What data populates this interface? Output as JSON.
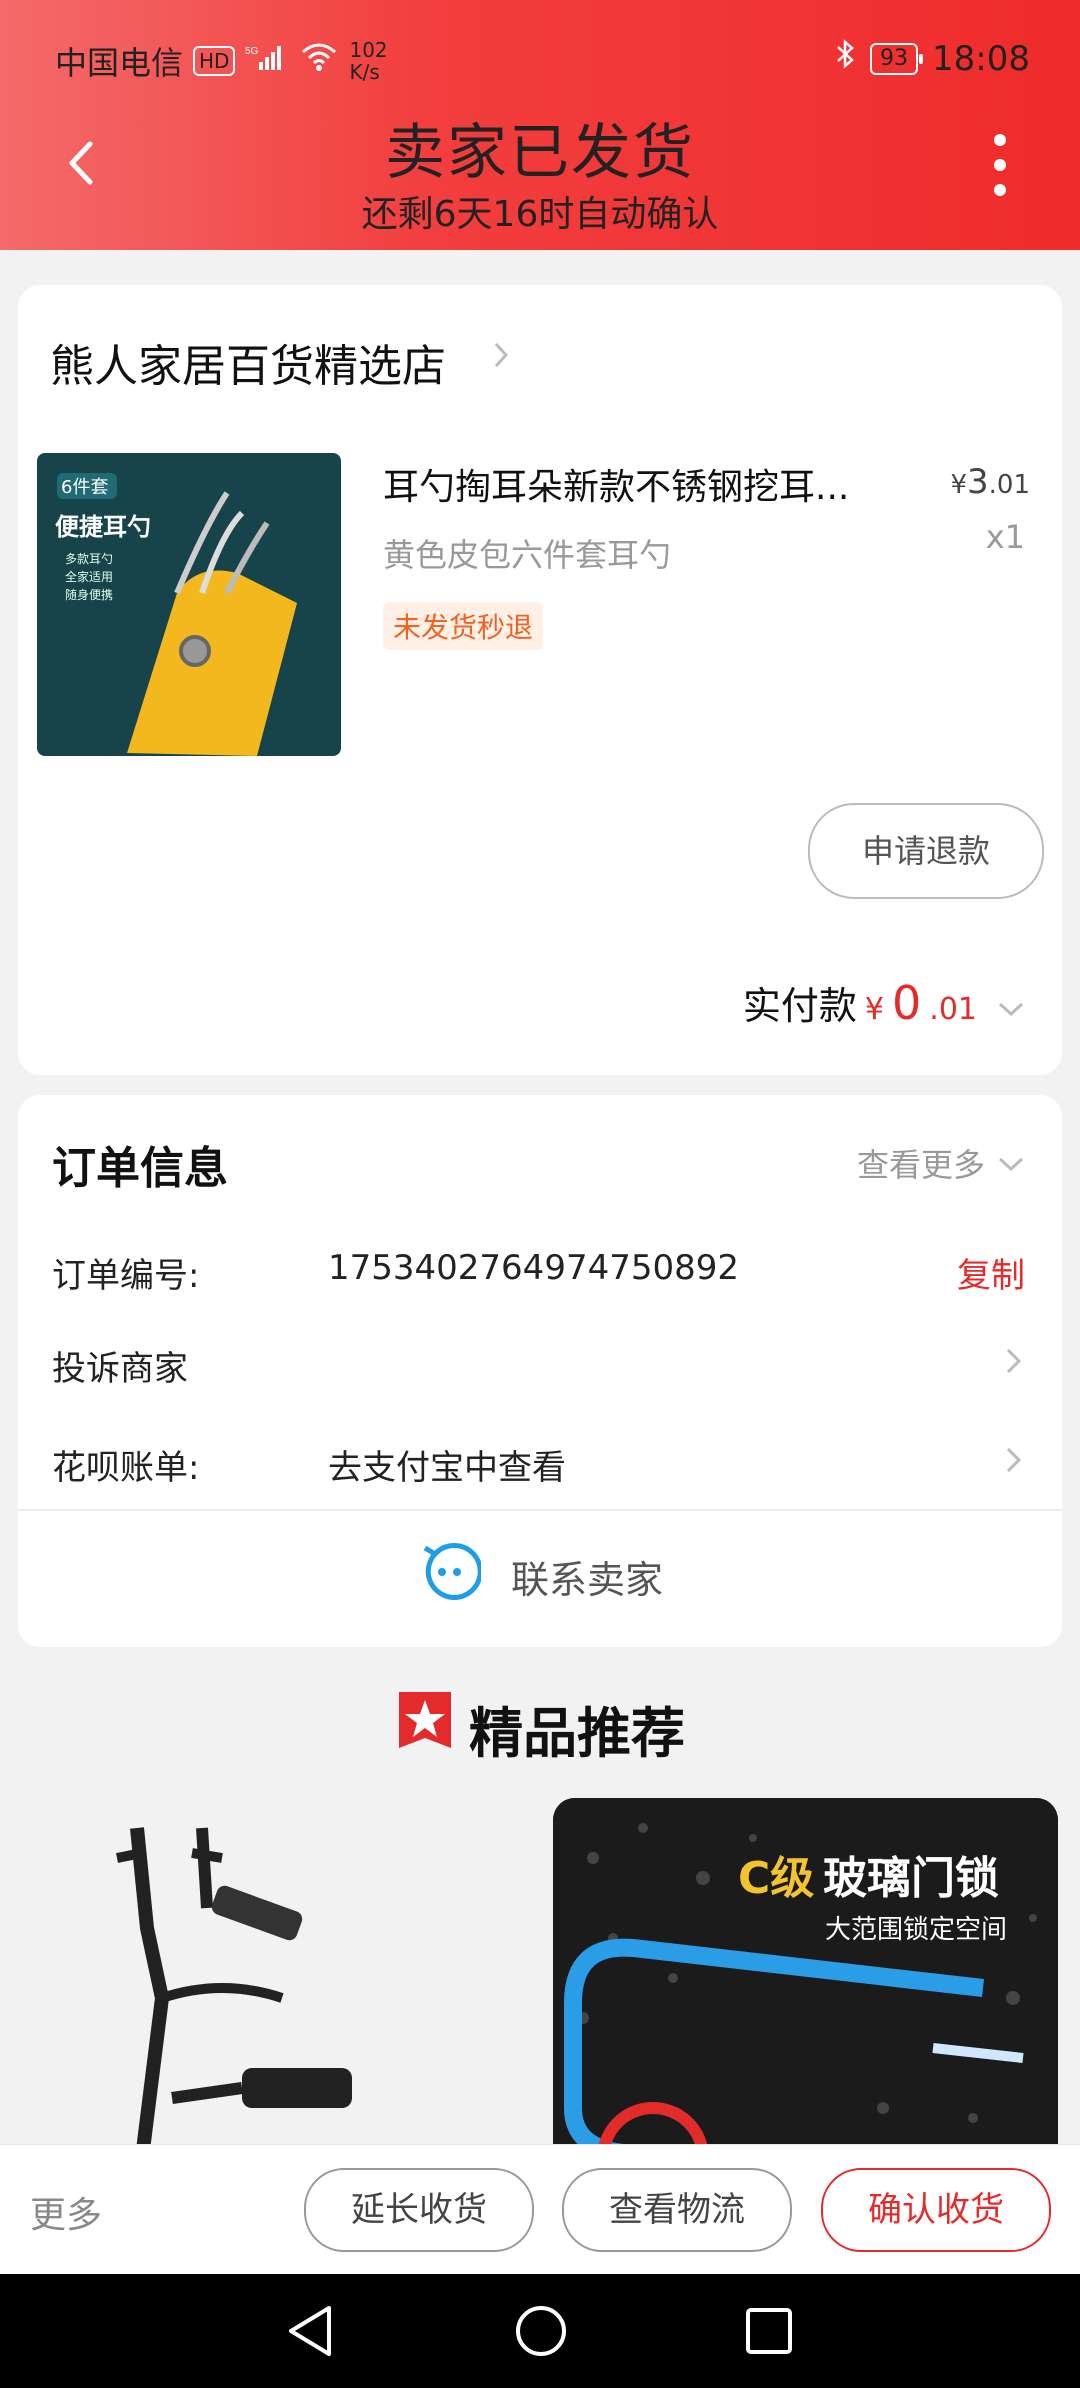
{
  "status_bar": {
    "carrier": "中国电信",
    "hd": "HD",
    "net_speed_value": "102",
    "net_speed_unit": "K/s",
    "battery": "93",
    "time": "18:08"
  },
  "header": {
    "title": "卖家已发货",
    "subtitle": "还剩6天16时自动确认"
  },
  "store": {
    "name": "熊人家居百货精选店",
    "product": {
      "title": "耳勺掏耳朵新款不锈钢挖耳...",
      "price_symbol": "¥",
      "price_int": "3",
      "price_dec": ".01",
      "sku": "黄色皮包六件套耳勺",
      "qty": "x1",
      "tag": "未发货秒退",
      "image_text": {
        "count": "6件套",
        "title": "便捷耳勺",
        "bullets": [
          "多款耳勺",
          "全家适用",
          "随身便携"
        ]
      }
    },
    "refund_button": "申请退款",
    "paid_label": "实付款",
    "paid_symbol": "¥",
    "paid_int": "0",
    "paid_dec": ".01"
  },
  "order_info": {
    "title": "订单信息",
    "more": "查看更多",
    "order_no_label": "订单编号:",
    "order_no": "1753402764974750892",
    "copy": "复制",
    "complain": "投诉商家",
    "huabei_label": "花呗账单:",
    "huabei_value": "去支付宝中查看",
    "contact": "联系卖家"
  },
  "recommend": {
    "title": "精品推荐",
    "item2_title_prefix": "C级",
    "item2_title_suffix": "玻璃门锁",
    "item2_subtitle": "大范围锁定空间"
  },
  "bottom_bar": {
    "more": "更多",
    "extend": "延长收货",
    "logistics": "查看物流",
    "confirm": "确认收货"
  },
  "colors": {
    "header_red": "#ef2b2b",
    "accent_red": "#e42b2b",
    "tag_orange": "#f26226"
  }
}
